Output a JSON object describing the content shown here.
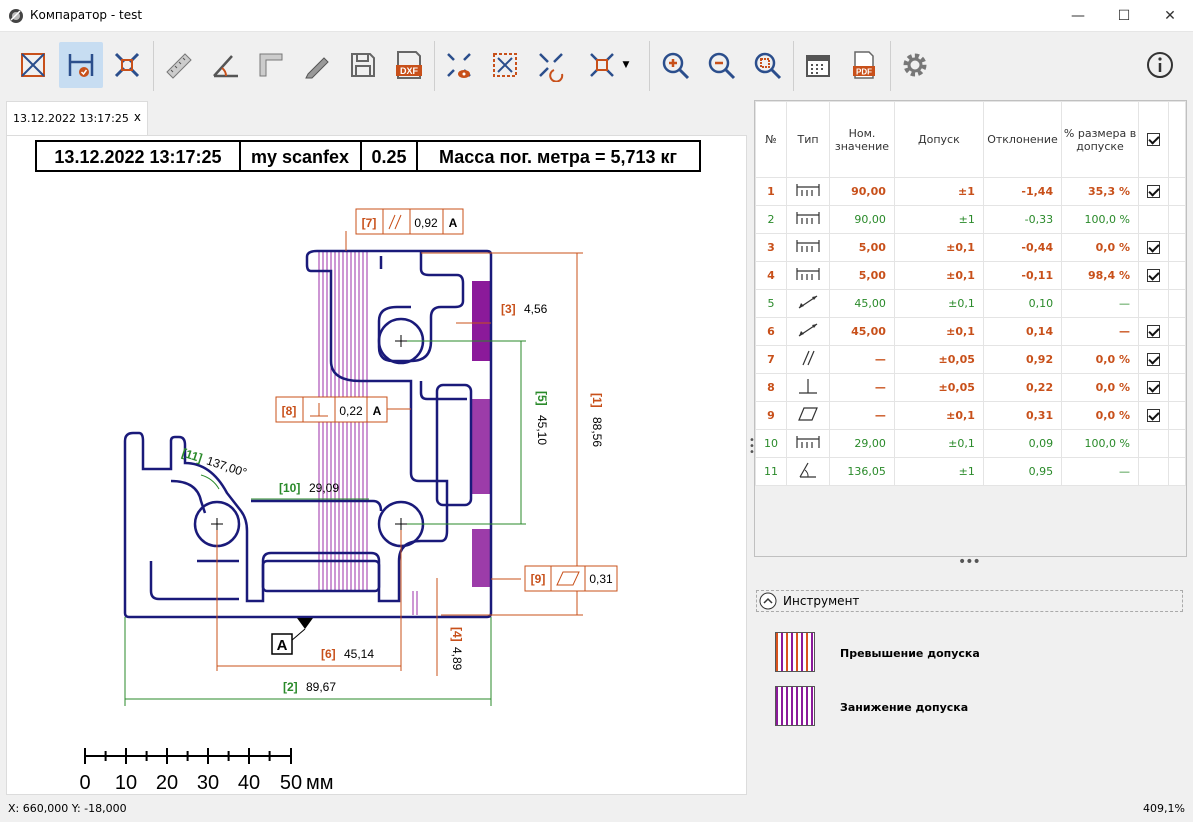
{
  "window": {
    "title": "Компаратор - test",
    "minimize": "—",
    "maximize": "☐",
    "close": "✕"
  },
  "toolbar": {
    "buttons": [
      "fit-view",
      "measure-dimension",
      "fit-all",
      "ruler",
      "angle",
      "corner",
      "pencil",
      "save",
      "save-dxf",
      "view-scan",
      "select-region",
      "swap-view",
      "overlay-menu",
      "zoom-in",
      "zoom-out",
      "zoom-fit",
      "calendar",
      "pdf-export",
      "settings",
      "info"
    ],
    "dxf_label": "DXF",
    "pdf_label": "PDF"
  },
  "tab": {
    "label": "13.12.2022 13:17:25",
    "close": "x"
  },
  "drawing": {
    "header": [
      "13.12.2022 13:17:25",
      "my scanfex",
      "0.25",
      "Масса пог. метра = 5,713 кг"
    ],
    "callouts": {
      "c7": {
        "id": "[7]",
        "value": "0,92",
        "datum": "A"
      },
      "c8": {
        "id": "[8]",
        "value": "0,22",
        "datum": "A"
      },
      "c9": {
        "id": "[9]",
        "value": "0,31"
      },
      "c3": {
        "id": "[3]",
        "value": "4,56"
      },
      "c5": {
        "id": "[5]",
        "value": "45,10"
      },
      "c1": {
        "id": "[1]",
        "value": "88,56"
      },
      "c10": {
        "id": "[10]",
        "value": "29,09"
      },
      "c11": {
        "id": "[11]",
        "value": "137,00°"
      },
      "c6": {
        "id": "[6]",
        "value": "45,14"
      },
      "c4": {
        "id": "[4]",
        "value": "4,89"
      },
      "c2": {
        "id": "[2]",
        "value": "89,67"
      },
      "datum": "A"
    },
    "scale": {
      "labels": [
        "0",
        "10",
        "20",
        "30",
        "40",
        "50"
      ],
      "unit": "мм"
    }
  },
  "table": {
    "headers": [
      "№",
      "Тип",
      "Ном. значение",
      "Допуск",
      "Отклонение",
      "% размера в допуске"
    ],
    "rows": [
      {
        "no": "1",
        "type": "distance",
        "nom": "90,00",
        "tol": "±1",
        "dev": "-1,44",
        "pct": "35,3 %",
        "checked": true,
        "status": "bad"
      },
      {
        "no": "2",
        "type": "distance",
        "nom": "90,00",
        "tol": "±1",
        "dev": "-0,33",
        "pct": "100,0 %",
        "checked": false,
        "status": "good"
      },
      {
        "no": "3",
        "type": "distance",
        "nom": "5,00",
        "tol": "±0,1",
        "dev": "-0,44",
        "pct": "0,0 %",
        "checked": true,
        "status": "bad"
      },
      {
        "no": "4",
        "type": "distance",
        "nom": "5,00",
        "tol": "±0,1",
        "dev": "-0,11",
        "pct": "98,4 %",
        "checked": true,
        "status": "bad"
      },
      {
        "no": "5",
        "type": "diagonal",
        "nom": "45,00",
        "tol": "±0,1",
        "dev": "0,10",
        "pct": "—",
        "checked": false,
        "status": "good"
      },
      {
        "no": "6",
        "type": "diagonal",
        "nom": "45,00",
        "tol": "±0,1",
        "dev": "0,14",
        "pct": "—",
        "checked": true,
        "status": "bad"
      },
      {
        "no": "7",
        "type": "parallel",
        "nom": "—",
        "tol": "±0,05",
        "dev": "0,92",
        "pct": "0,0 %",
        "checked": true,
        "status": "bad"
      },
      {
        "no": "8",
        "type": "perpendicular",
        "nom": "—",
        "tol": "±0,05",
        "dev": "0,22",
        "pct": "0,0 %",
        "checked": true,
        "status": "bad"
      },
      {
        "no": "9",
        "type": "flatness",
        "nom": "—",
        "tol": "±0,1",
        "dev": "0,31",
        "pct": "0,0 %",
        "checked": true,
        "status": "bad"
      },
      {
        "no": "10",
        "type": "distance",
        "nom": "29,00",
        "tol": "±0,1",
        "dev": "0,09",
        "pct": "100,0 %",
        "checked": false,
        "status": "good"
      },
      {
        "no": "11",
        "type": "angle",
        "nom": "136,05",
        "tol": "±1",
        "dev": "0,95",
        "pct": "—",
        "checked": false,
        "status": "good"
      }
    ]
  },
  "instrument": {
    "label": "Инструмент"
  },
  "legend": {
    "over": "Превышение допуска",
    "under": "Занижение допуска"
  },
  "status": {
    "coords": "X: 660,000 Y: -18,000",
    "zoom": "409,1%"
  },
  "colors": {
    "accent": "#d35400",
    "ok": "#2a8a2a",
    "purple": "#8b1a9a",
    "navy": "#1a1a7a"
  }
}
